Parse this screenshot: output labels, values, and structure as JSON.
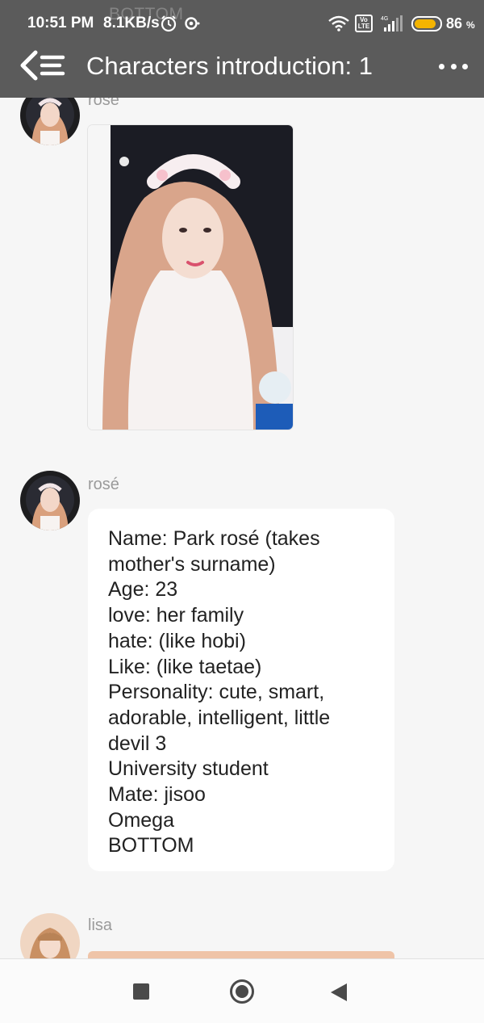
{
  "status_bar": {
    "time": "10:51 PM",
    "speed": "8.1KB/s",
    "volte": "Vo LTE",
    "battery_percent": "86",
    "battery_unit": "%",
    "battery_level": 0.86,
    "battery_color": "#f4b400",
    "icons": [
      "alarm-icon",
      "hotspot-icon",
      "wifi-icon",
      "volte-icon",
      "signal-icon",
      "battery-icon"
    ]
  },
  "header": {
    "title": "Characters introduction: 1",
    "background": "#5b5b5b",
    "back_icon": "back-menu-icon",
    "more_icon": "more-horizontal-icon"
  },
  "overlay_ghost_text": "BOTTOM",
  "messages": [
    {
      "sender": "rosé",
      "type": "image",
      "image_desc_icon": "photo"
    },
    {
      "sender": "rosé",
      "type": "text",
      "lines": [
        "Name: Park rosé (takes",
        "mother's surname)",
        "Age: 23",
        "love: her family",
        "hate: (like hobi)",
        "Like: (like taetae)",
        "Personality: cute, smart,",
        "adorable, intelligent, little",
        "devil 3",
        "University student",
        "Mate: jisoo",
        "Omega",
        "BOTTOM"
      ]
    },
    {
      "sender": "lisa",
      "type": "image"
    }
  ],
  "navbar": {
    "icons": [
      "recent-apps-icon",
      "home-icon",
      "back-icon"
    ]
  }
}
